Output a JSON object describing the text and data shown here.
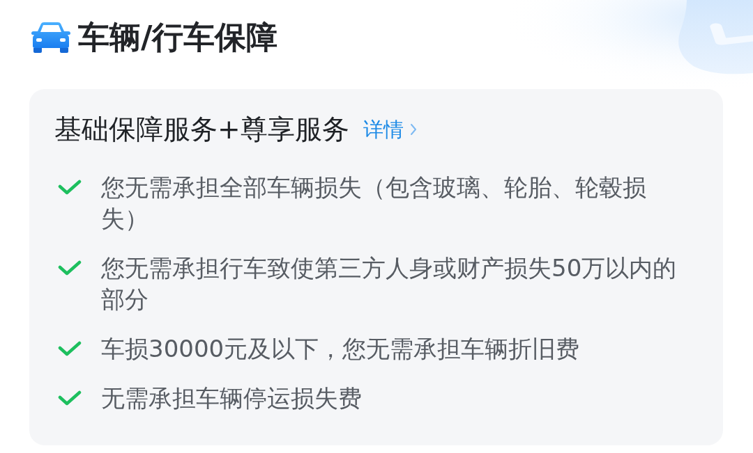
{
  "header": {
    "title": "车辆/行车保障"
  },
  "card": {
    "title": "基础保障服务+尊享服务",
    "link": "详情",
    "items": [
      "您无需承担全部车辆损失（包含玻璃、轮胎、轮毂损失）",
      "您无需承担行车致使第三方人身或财产损失50万以内的部分",
      "车损30000元及以下，您无需承担车辆折旧费",
      "无需承担车辆停运损失费"
    ]
  }
}
